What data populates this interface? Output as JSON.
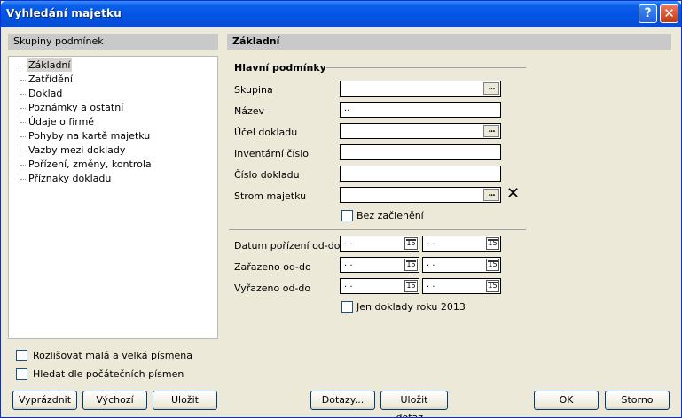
{
  "window": {
    "title": "Vyhledání majetku",
    "help_label": "?",
    "close_label": "✕"
  },
  "left": {
    "header": "Skupiny podmínek",
    "tree": [
      "Základní",
      "Zatřídění",
      "Doklad",
      "Poznámky a ostatní",
      "Údaje o firmě",
      "Pohyby na kartě majetku",
      "Vazby mezi doklady",
      "Pořízení, změny, kontrola",
      "Příznaky dokladu"
    ],
    "selected_index": 0,
    "options": [
      "Rozlišovat malá a velká písmena",
      "Hledat dle počátečních písmen"
    ]
  },
  "right": {
    "header": "Základní",
    "section_main": "Hlavní podmínky",
    "fields": {
      "skupina": {
        "label": "Skupina",
        "value": ""
      },
      "nazev": {
        "label": "Název",
        "value": ".."
      },
      "ucel": {
        "label": "Účel dokladu",
        "value": ""
      },
      "inventarni": {
        "label": "Inventární číslo",
        "value": ""
      },
      "cislo": {
        "label": "Číslo dokladu",
        "value": ""
      },
      "strom": {
        "label": "Strom majetku",
        "value": ""
      }
    },
    "ellipsis_label": "...",
    "clear_icon_glyph": "✕",
    "bez_zacleneni": "Bez začlenění",
    "dates": {
      "porizeni": {
        "label": "Datum pořízení od-do",
        "from": ". .",
        "to": ". ."
      },
      "zarazeno": {
        "label": "Zařazeno od-do",
        "from": ". .",
        "to": ". ."
      },
      "vyrazeno": {
        "label": "Vyřazeno od-do",
        "from": ". .",
        "to": ". ."
      }
    },
    "calendar_glyph": "15",
    "jen_doklady": "Jen doklady roku 2013"
  },
  "buttons": {
    "vyprazdnit": "Vyprázdnit",
    "vychozi": "Výchozí",
    "ulozit": "Uložit",
    "dotazy": "Dotazy...",
    "ulozit_dotaz": "Uložit dotaz...",
    "ok": "OK",
    "storno": "Storno"
  }
}
